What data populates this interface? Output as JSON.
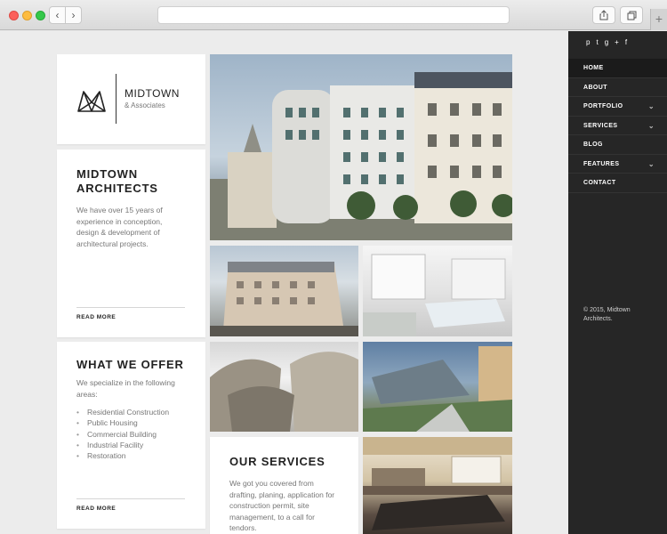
{
  "browser": {
    "close_color": "#fc605b",
    "minimize_color": "#fdbc40",
    "maximize_color": "#34c84a",
    "back_icon": "chevron-left-icon",
    "forward_icon": "chevron-right-icon",
    "share_icon": "share-icon",
    "tabs_icon": "tabs-icon",
    "new_tab_icon": "plus-icon"
  },
  "logo": {
    "name": "MIDTOWN",
    "subtitle": "& Associates"
  },
  "about": {
    "title": "MIDTOWN ARCHITECTS",
    "text": "We have over 15 years of experience in conception, design & development of architectural projects.",
    "read_more": "READ MORE"
  },
  "offer": {
    "title": "WHAT WE OFFER",
    "intro": "We specialize in the following areas:",
    "items": [
      "Residential Construction",
      "Public Housing",
      "Commercial Building",
      "Industrial Facility",
      "Restoration"
    ],
    "read_more": "READ MORE"
  },
  "services": {
    "title": "OUR SERVICES",
    "text": "We got you covered from drafting, planing, application for construction permit, site management, to a call for tendors."
  },
  "sidebar": {
    "social": [
      "p",
      "t",
      "g+",
      "f"
    ],
    "nav": [
      {
        "label": "HOME",
        "has_submenu": false
      },
      {
        "label": "ABOUT",
        "has_submenu": false
      },
      {
        "label": "PORTFOLIO",
        "has_submenu": true
      },
      {
        "label": "SERVICES",
        "has_submenu": true
      },
      {
        "label": "BLOG",
        "has_submenu": false
      },
      {
        "label": "FEATURES",
        "has_submenu": true
      },
      {
        "label": "CONTACT",
        "has_submenu": false
      }
    ],
    "copyright": "© 2015, Midtown Architects."
  },
  "colors": {
    "sidebar_bg": "#262626",
    "page_bg": "#ececec",
    "accent_text": "#222222"
  }
}
